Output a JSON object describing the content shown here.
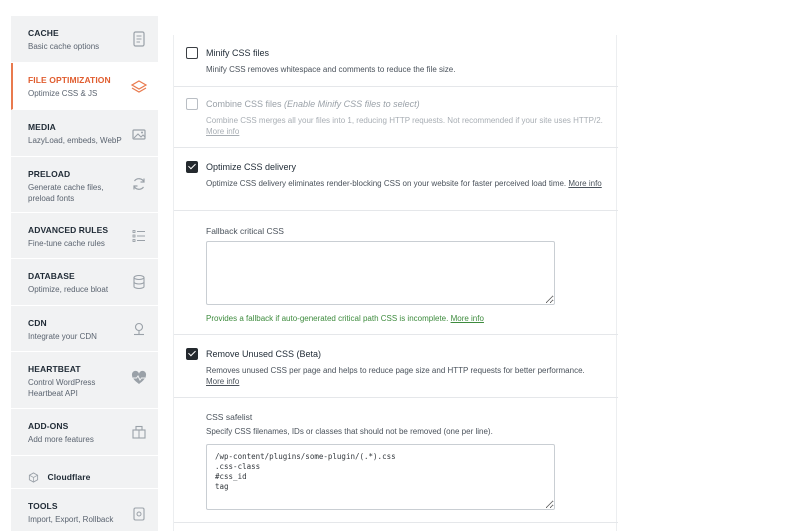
{
  "sidebar": {
    "items": [
      {
        "title": "CACHE",
        "desc": "Basic cache options",
        "icon": "document-icon"
      },
      {
        "title": "FILE OPTIMIZATION",
        "desc": "Optimize CSS & JS",
        "icon": "layers-icon"
      },
      {
        "title": "MEDIA",
        "desc": "LazyLoad, embeds, WebP",
        "icon": "image-icon"
      },
      {
        "title": "PRELOAD",
        "desc": "Generate cache files, preload fonts",
        "icon": "refresh-icon"
      },
      {
        "title": "ADVANCED RULES",
        "desc": "Fine-tune cache rules",
        "icon": "list-icon"
      },
      {
        "title": "DATABASE",
        "desc": "Optimize, reduce bloat",
        "icon": "database-icon"
      },
      {
        "title": "CDN",
        "desc": "Integrate your CDN",
        "icon": "cdn-icon"
      },
      {
        "title": "HEARTBEAT",
        "desc": "Control WordPress Heartbeat API",
        "icon": "heart-pulse-icon"
      },
      {
        "title": "ADD-ONS",
        "desc": "Add more features",
        "icon": "puzzle-icon"
      },
      {
        "title": "Cloudflare",
        "desc": "",
        "icon": "cloudflare-icon"
      },
      {
        "title": "TOOLS",
        "desc": "Import, Export, Rollback",
        "icon": "tools-icon"
      }
    ],
    "active_index": 1,
    "accent_color": "#e97a4e"
  },
  "options": {
    "minify": {
      "label": "Minify CSS files",
      "desc": "Minify CSS removes whitespace and comments to reduce the file size.",
      "checked": false
    },
    "combine": {
      "label": "Combine CSS files",
      "note": "(Enable Minify CSS files to select)",
      "desc": "Combine CSS merges all your files into 1, reducing HTTP requests. Not recommended if your site uses HTTP/2.",
      "link": "More info",
      "checked": false,
      "disabled": true
    },
    "optimize_delivery": {
      "label": "Optimize CSS delivery",
      "desc": "Optimize CSS delivery eliminates render-blocking CSS on your website for faster perceived load time.",
      "link": "More info",
      "checked": true
    },
    "fallback": {
      "title": "Fallback critical CSS",
      "value": "",
      "help": "Provides a fallback if auto-generated critical path CSS is incomplete.",
      "link": "More info"
    },
    "remove_unused": {
      "label": "Remove Unused CSS (Beta)",
      "desc": "Removes unused CSS per page and helps to reduce page size and HTTP requests for better performance.",
      "link": "More info",
      "checked": true
    },
    "safelist": {
      "title": "CSS safelist",
      "desc": "Specify CSS filenames, IDs or classes that should not be removed (one per line).",
      "value": "/wp-content/plugins/some-plugin/(.*).css\n.css-class\n#css_id\ntag"
    }
  }
}
